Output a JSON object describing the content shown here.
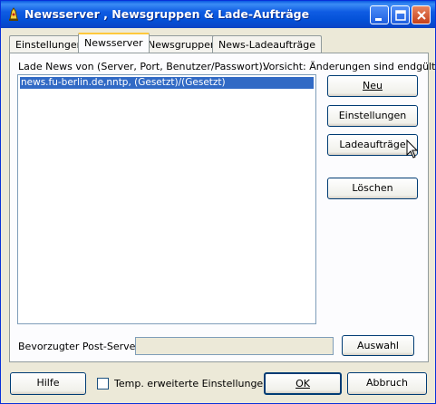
{
  "window": {
    "title": "Newsserver , Newsgruppen & Lade-Aufträge"
  },
  "tabs": [
    {
      "label": "Einstellungen"
    },
    {
      "label": "Newsserver"
    },
    {
      "label": "Newsgruppen"
    },
    {
      "label": "News-Ladeaufträge"
    }
  ],
  "panel": {
    "list_label": "Lade News von (Server, Port, Benutzer/Passwort):",
    "warning": "Vorsicht: Änderungen sind endgültig!",
    "servers": [
      "news.fu-berlin.de,nntp, (Gesetzt)/(Gesetzt)"
    ],
    "buttons": {
      "new_label": "Neu",
      "settings_label": "Einstellungen",
      "jobs_label": "Ladeaufträge",
      "delete_label": "Löschen"
    },
    "post_server_label": "Bevorzugter Post-Server:",
    "post_server_value": "",
    "select_label": "Auswahl"
  },
  "footer": {
    "help_label": "Hilfe",
    "temp_checkbox_label": "Temp. erweiterte Einstellungen",
    "temp_checkbox_checked": false,
    "ok_label": "OK",
    "cancel_label": "Abbruch"
  }
}
